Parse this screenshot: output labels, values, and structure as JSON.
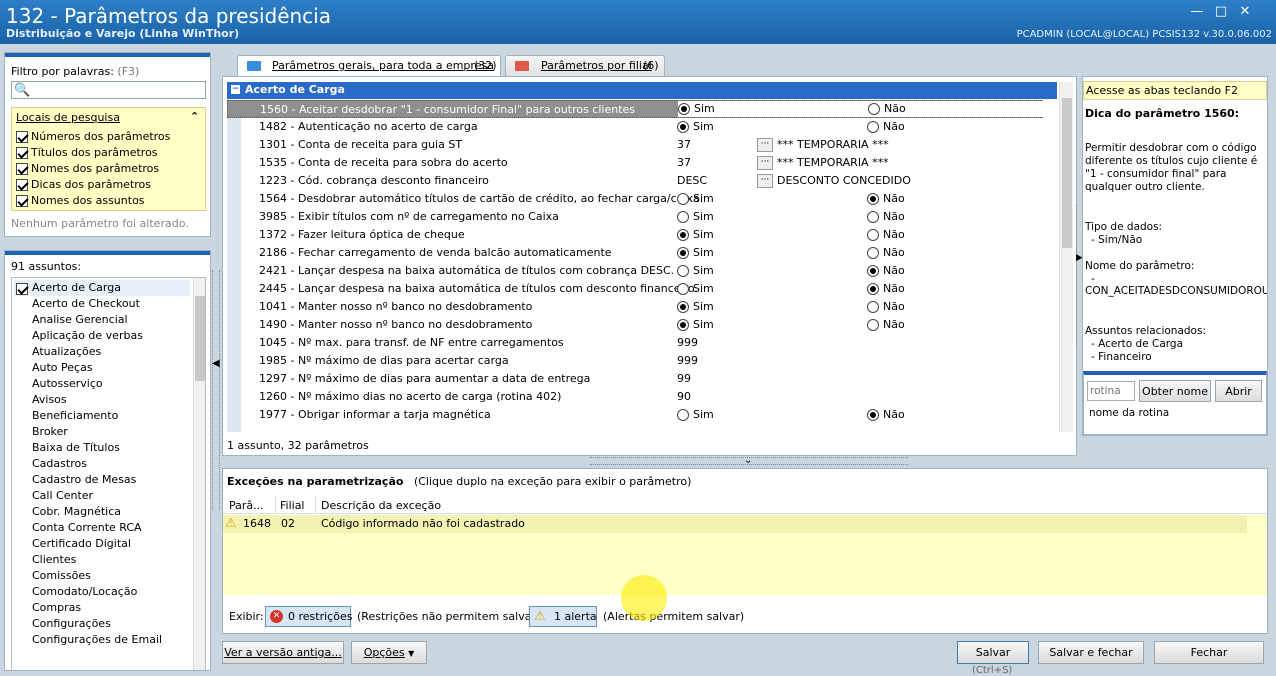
{
  "window": {
    "title": "132 - Parâmetros da presidência",
    "subtitle": "Distribuição e Varejo (Linha WinThor)",
    "user_info": "PCADMIN (LOCAL@LOCAL)   PCSIS132  v.30.0.06.002"
  },
  "filter": {
    "label": "Filtro por palavras:",
    "shortcut": "(F3)",
    "search_value": "",
    "locais_title": "Locais de pesquisa",
    "locais": [
      {
        "label": "Números dos parâmetros",
        "checked": true
      },
      {
        "label": "Títulos dos parâmetros",
        "checked": true
      },
      {
        "label": "Nomes dos parâmetros",
        "checked": true
      },
      {
        "label": "Dicas dos parâmetros",
        "checked": true
      },
      {
        "label": "Nomes dos assuntos",
        "checked": true
      }
    ],
    "status": "Nenhum parâmetro foi alterado."
  },
  "subjects": {
    "count_label": "91 assuntos:",
    "items": [
      "Acerto de Carga",
      "Acerto de Checkout",
      "Analise Gerencial",
      "Aplicação de verbas",
      "Atualizações",
      "Auto Peças",
      "Autosserviço",
      "Avisos",
      "Beneficiamento",
      "Broker",
      "Baixa de Títulos",
      "Cadastros",
      "Cadastro de Mesas",
      "Call Center",
      "Cobr. Magnética",
      "Conta Corrente RCA",
      "Certificado Digital",
      "Clientes",
      "Comissões",
      "Comodato/Locação",
      "Compras",
      "Configurações",
      "Configurações de Email"
    ],
    "selected_index": 0
  },
  "tabs": [
    {
      "label": "Parâmetros gerais, para toda a empresa",
      "count": "(32)",
      "active": true
    },
    {
      "label": "Parâmetros por filial",
      "count": "(6)",
      "active": false
    }
  ],
  "grid": {
    "group_title": "Acerto de Carga",
    "rows": [
      {
        "label": "1560 - Aceitar desdobrar \"1 - consumidor Final\" para outros clientes",
        "kind": "radio",
        "value": "Sim",
        "opt1": "Sim",
        "opt2": "Não",
        "selected": true
      },
      {
        "label": "1482 - Autenticação no acerto de carga",
        "kind": "radio",
        "value": "Sim",
        "opt1": "Sim",
        "opt2": "Não"
      },
      {
        "label": "1301 - Conta de receita para guia ST",
        "kind": "lookup",
        "code": "37",
        "desc": "*** TEMPORARIA ***"
      },
      {
        "label": "1535 - Conta de receita para sobra do acerto",
        "kind": "lookup",
        "code": "37",
        "desc": "*** TEMPORARIA ***"
      },
      {
        "label": "1223 - Cód. cobrança desconto financeiro",
        "kind": "lookup",
        "code": "DESC",
        "desc": "DESCONTO CONCEDIDO"
      },
      {
        "label": "1564 - Desdobrar automático títulos de cartão de crédito, ao fechar carga/caixa",
        "kind": "radio",
        "value": "Não",
        "opt1": "Sim",
        "opt2": "Não"
      },
      {
        "label": "3985 - Exibir títulos com nº de carregamento no Caixa",
        "kind": "radio",
        "value": "",
        "opt1": "Sim",
        "opt2": "Não"
      },
      {
        "label": "1372 - Fazer leitura óptica de cheque",
        "kind": "radio",
        "value": "Sim",
        "opt1": "Sim",
        "opt2": "Não"
      },
      {
        "label": "2186 - Fechar carregamento de venda balcão automaticamente",
        "kind": "radio",
        "value": "Sim",
        "opt1": "Sim",
        "opt2": "Não"
      },
      {
        "label": "2421 - Lançar despesa na baixa automática de títulos com cobrança DESC.",
        "kind": "radio",
        "value": "Não",
        "opt1": "Sim",
        "opt2": "Não"
      },
      {
        "label": "2445 - Lançar despesa na baixa automática de títulos com desconto financeiro.",
        "kind": "radio",
        "value": "Não",
        "opt1": "Sim",
        "opt2": "Não"
      },
      {
        "label": "1041 - Manter nosso nº banco no desdobramento",
        "kind": "radio",
        "value": "Sim",
        "opt1": "Sim",
        "opt2": "Não"
      },
      {
        "label": "1490 - Manter nosso nº banco no desdobramento",
        "kind": "radio",
        "value": "Sim",
        "opt1": "Sim",
        "opt2": "Não"
      },
      {
        "label": "1045 - Nº max. para transf. de NF entre carregamentos",
        "kind": "text",
        "code": "999"
      },
      {
        "label": "1985 - Nº máximo de dias para acertar carga",
        "kind": "text",
        "code": "999"
      },
      {
        "label": "1297 - Nº máximo de dias para aumentar a data de entrega",
        "kind": "text",
        "code": "99"
      },
      {
        "label": "1260 - Nº máximo dias no acerto de carga (rotina 402)",
        "kind": "text",
        "code": "90"
      },
      {
        "label": "1977 - Obrigar informar a tarja magnética",
        "kind": "radio",
        "value": "Não",
        "opt1": "Sim",
        "opt2": "Não"
      }
    ],
    "summary": "1 assunto, 32 parâmetros"
  },
  "help": {
    "hint": "Acesse as abas teclando F2",
    "title": "Dica do parâmetro 1560:",
    "body": "Permitir desdobrar com o código diferente os títulos cujo cliente é \"1 - consumidor final\" para qualquer outro cliente.",
    "type_label": "Tipo de dados:",
    "type_value": "- Sim/Não",
    "name_label": "Nome do parâmetro:",
    "name_dash": "-",
    "name_value": "CON_ACEITADESDCONSUMIDOROUT",
    "related_label": "Assuntos relacionados:",
    "related": [
      "- Acerto de Carga",
      "- Financeiro"
    ],
    "rotina_placeholder": "rotina",
    "obter_nome": "Obter nome",
    "abrir": "Abrir",
    "rotina_name": "nome da rotina"
  },
  "exceptions": {
    "title": "Exceções na parametrização",
    "hint": "(Clique duplo na exceção para exibir o parâmetro)",
    "columns": [
      "Parâ...",
      "Filial",
      "Descrição da exceção"
    ],
    "rows": [
      {
        "param": "1648",
        "filial": "02",
        "desc": "Código informado não foi cadastrado"
      }
    ],
    "exibir": "Exibir:",
    "restricoes": "0 restrições",
    "restricoes_note": "(Restrições não permitem salvar)",
    "alertas": "1 alerta",
    "alertas_note": "(Alertas permitem salvar)"
  },
  "footer": {
    "old_version": "Ver a versão antiga...",
    "options": "Opções",
    "save": "Salvar",
    "save_shortcut": "(Ctrl+S)",
    "save_close": "Salvar e fechar",
    "close": "Fechar"
  }
}
